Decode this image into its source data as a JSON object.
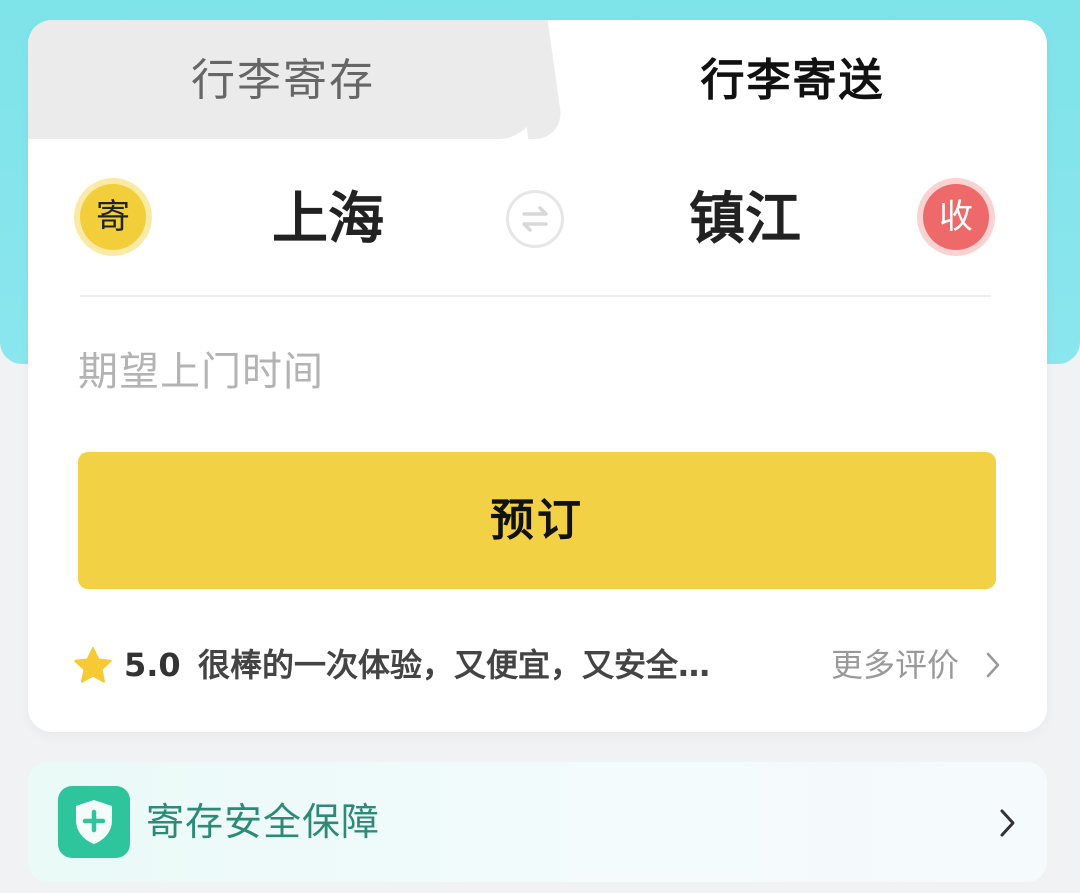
{
  "tabs": [
    {
      "label": "行李寄存",
      "active": false
    },
    {
      "label": "行李寄送",
      "active": true
    }
  ],
  "route": {
    "send_badge": "寄",
    "from_city": "上海",
    "to_city": "镇江",
    "recv_badge": "收",
    "swap_icon": "swap-arrows-icon"
  },
  "pickup_time": {
    "placeholder": "期望上门时间"
  },
  "booking": {
    "button_label": "预订"
  },
  "review": {
    "star_icon": "star-icon",
    "rating": "5.0",
    "text": "很棒的一次体验，又便宜，又安全…",
    "more_label": "更多评价"
  },
  "safety": {
    "icon": "shield-plus-icon",
    "label": "寄存安全保障"
  },
  "colors": {
    "teal": "#8be6ee",
    "yellow": "#f2d244",
    "send_badge": "#f2cf3a",
    "recv_badge": "#ee6a6a",
    "shield": "#2fc59c"
  }
}
